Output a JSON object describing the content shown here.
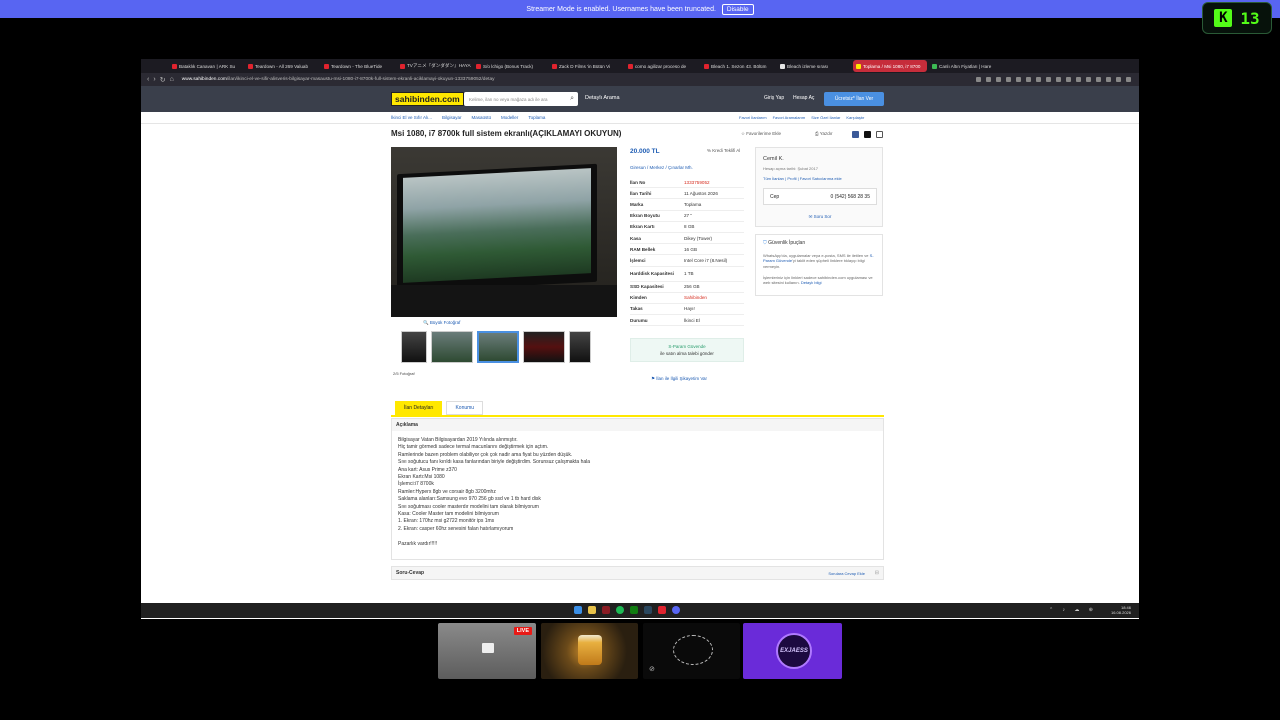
{
  "banner": {
    "text": "Streamer Mode is enabled. Usernames have been truncated.",
    "button": "Disable"
  },
  "kick": {
    "logo": "K",
    "count": "13"
  },
  "browser": {
    "tabs": [
      {
        "label": "Bataklık Canavarı | ARK Su",
        "color": "#e0232e"
      },
      {
        "label": "Teardown - All 269 Valuab",
        "color": "#e0232e"
      },
      {
        "label": "Teardown - The BlueTide",
        "color": "#e0232e"
      },
      {
        "label": "TVアニメ『ダンダダン』HAYASE",
        "color": "#e0232e"
      },
      {
        "label": "S/o lchigo (Bonus Track)",
        "color": "#e0232e"
      },
      {
        "label": "Zack D Films 'in Bütün Vi",
        "color": "#e0232e"
      },
      {
        "label": "como agilizar proceso de",
        "color": "#e0232e"
      },
      {
        "label": "Bleach 1. Sezon 43. Bölüm",
        "color": "#e0232e"
      },
      {
        "label": "Bleach izleme sırası",
        "color": "#e6e6e6"
      },
      {
        "label": "Toplama / Msi 1080, i7 8700",
        "color": "#ffe800",
        "active": true
      },
      {
        "label": "Canlı Altın Fiyatları | Hare",
        "color": "#3cba54"
      }
    ],
    "url_domain": "www.sahibinden.com",
    "url_path": "/ilan/ikinci-el-ve-sifir-alisveris-bilgisayar-masaustu-msi-1080-i7-8700k-full-sistem-ekranli-aciklamayi-okuyun-1333759052/detay"
  },
  "site": {
    "logo": "sahibinden.com",
    "search_placeholder": "Kelime, ilan no veya mağaza adı ile ara",
    "detailed_search": "Detaylı Arama",
    "login": "Giriş Yap",
    "register": "Hesap Aç",
    "post_ad": "Ücretsiz* İlan Ver",
    "breadcrumbs": [
      "İkinci El ve Sıfır Alı...",
      "Bilgisayar",
      "Masaüstü",
      "Modeller",
      "Toplama"
    ],
    "crumb_right": [
      "Favori İlanlarım",
      "Favori Aramalarım",
      "Size Özel İlanlar",
      "Karşılaştır"
    ]
  },
  "listing": {
    "title": "Msi 1080, i7 8700k full sistem ekranlı(AÇIKLAMAYI OKUYUN)",
    "add_favorites": "Favorilerime Ekle",
    "print": "Yazdır",
    "price": "20.000 TL",
    "credit": "Kredi Teklifi Al",
    "location": "Giresun  /  Merkez  /  Çınarlar Mh.",
    "big_photo": "Büyük Fotoğraf",
    "photo_count": "2/5 Fotoğraf",
    "attributes": [
      {
        "k": "İlan No",
        "v": "1333759052",
        "red": true
      },
      {
        "k": "İlan Tarihi",
        "v": "11 Ağustos 2026"
      },
      {
        "k": "Marka",
        "v": "Toplama"
      },
      {
        "k": "Ekran Boyutu",
        "v": "27 \""
      },
      {
        "k": "Ekran Kartı",
        "v": "8 GB"
      },
      {
        "k": "Kasa",
        "v": "Dikey (Tower)"
      },
      {
        "k": "RAM Bellek",
        "v": "16 GB"
      },
      {
        "k": "İşlemci",
        "v": "Intel Core i7 (8.Nesil)"
      },
      {
        "k": "Harddisk Kapasitesi",
        "v": "1 TB",
        "tall": true
      },
      {
        "k": "SSD Kapasitesi",
        "v": "256 GB"
      },
      {
        "k": "Kimden",
        "v": "Sahibinden",
        "red": true
      },
      {
        "k": "Takas",
        "v": "Hayır"
      },
      {
        "k": "Durumu",
        "v": "İkinci El"
      }
    ],
    "sparam_title": "S-Param Güvende",
    "sparam_sub": "ile satın alma talebi gönder",
    "complaint": "İlan ile İlgili Şikayetim Var"
  },
  "seller": {
    "name": "Cemil K.",
    "since": "Hesap açma tarihi: Şubat 2017",
    "links": "Tüm İlanları  |  Profil  |  Favori Satıcılarıma ekle",
    "phone_label": "Cep",
    "phone": "0 (542) 568 28 35",
    "ask": "Soru Sor"
  },
  "safety": {
    "heading": "Güvenlik İpuçları",
    "text1": "WhatsApp'da, uygulamalar veya e-posta, SMS ile iletilen ve",
    "link1": "S-Param Güvende",
    "text2": "'yi taklit eden şüpheli linklere tıklayıp bilgi vermeyin.",
    "text3": "İşlemleriniz için linkleri sadece sahibinden.com uygulaması ve web sitesini kullanın.",
    "link2": "Detaylı bilgi"
  },
  "detail_tabs": [
    "İlan Detayları",
    "Konumu"
  ],
  "description": {
    "heading": "Açıklama",
    "lines": [
      "Bilgisayar Vatan Bilgisayardan 2019 Yılında alınmıştır.",
      "Hiç tamir görmedi sadece termal macunlarını değiştirmek için açtım.",
      "Ramlerinde bazen problem olabiliyor çok çok nadir ama fiyat bu yüzden düşük.",
      "Sıvı soğutucu fanı kırıldı kasa fanlarından biriyle değiştirdim. Sorunsuz çalışmakta hala",
      "Ana kart: Asus Prime z370",
      "Ekran Kartı:Msi 1080",
      "İşlemci:i7 8700k",
      "Ramler:Hyperx 8gb ve corsair 8gb 3200mhz",
      "Saklama alanları:Samsung evo 970 256 gb ssd ve 1 tb hard disk",
      "Sıvı soğutması cooler masterdır modelini tam olarak bilmiyorum",
      "Kasa: Cooler Master tam modelini bilmiyorum",
      "1. Ekran: 170hz msi g2722 monitör ips 1ms",
      "2. Ekran: casper 60hz senesini falan hatırlamıyorum",
      "",
      "Pazarlık vardır!!!!!"
    ]
  },
  "qa": {
    "heading": "Soru-Cevap",
    "right": "Sorulara Cevap Ekle",
    "toggle": "⊟"
  },
  "taskbar": {
    "time": "18:46",
    "date": "16.08.2026",
    "tray": "⌃ ♪ ☁ ⊕"
  },
  "cams": {
    "live": "LIVE",
    "badge": "EXJAESS"
  }
}
